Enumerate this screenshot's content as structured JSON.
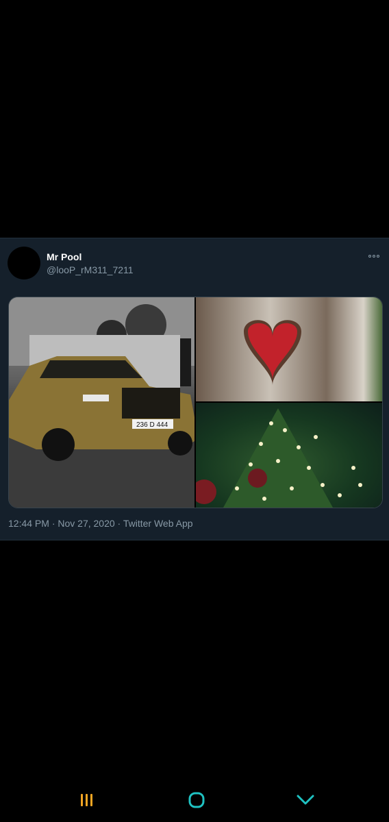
{
  "tweet": {
    "display_name": "Mr Pool",
    "handle": "@looP_rM311_7211",
    "timestamp": "12:44 PM · Nov 27, 2020 · Twitter Web App",
    "car_plate": "236 D 444"
  },
  "icons": {
    "more": "more-horizontal-icon",
    "recent_apps": "recent-apps-icon",
    "home": "home-icon",
    "back": "back-chevron-icon"
  },
  "colors": {
    "background": "#000000",
    "card": "#15202b",
    "secondary_text": "#8899a6",
    "nav_recent": "#f5a623",
    "nav_home_back": "#1fc2c2"
  }
}
